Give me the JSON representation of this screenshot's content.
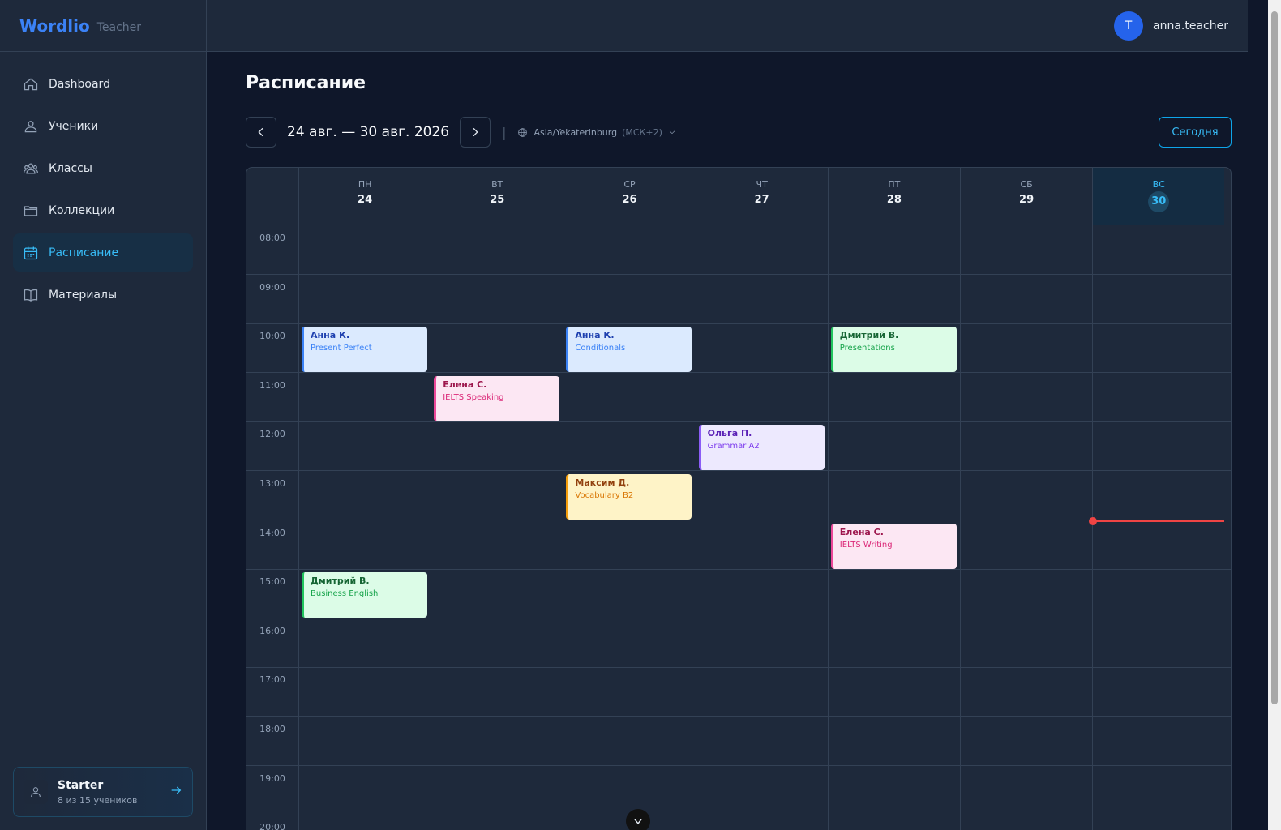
{
  "brand": {
    "name": "Wordlio",
    "role": "Teacher"
  },
  "nav": [
    {
      "label": "Dashboard",
      "icon": "home-icon"
    },
    {
      "label": "Ученики",
      "icon": "student-icon"
    },
    {
      "label": "Классы",
      "icon": "users-icon"
    },
    {
      "label": "Коллекции",
      "icon": "folder-icon"
    },
    {
      "label": "Расписание",
      "icon": "calendar-icon",
      "active": true
    },
    {
      "label": "Материалы",
      "icon": "book-icon"
    }
  ],
  "plan": {
    "title": "Starter",
    "subtitle": "8 из 15 учеников"
  },
  "user": {
    "initial": "T",
    "name": "anna.teacher"
  },
  "page": {
    "title": "Расписание"
  },
  "toolbar": {
    "range": "24 авг. — 30 авг. 2026",
    "separator": "|",
    "timezone": "Asia/Yekaterinburg",
    "timezone_offset": "(МСК+2)",
    "today_label": "Сегодня"
  },
  "calendar": {
    "days": [
      {
        "name": "ПН",
        "num": "24"
      },
      {
        "name": "ВТ",
        "num": "25"
      },
      {
        "name": "СР",
        "num": "26"
      },
      {
        "name": "ЧТ",
        "num": "27"
      },
      {
        "name": "ПТ",
        "num": "28"
      },
      {
        "name": "СБ",
        "num": "29"
      },
      {
        "name": "ВС",
        "num": "30",
        "today": true
      }
    ],
    "hours": [
      "08:00",
      "09:00",
      "10:00",
      "11:00",
      "12:00",
      "13:00",
      "14:00",
      "15:00",
      "16:00",
      "17:00",
      "18:00",
      "19:00",
      "20:00"
    ],
    "events": [
      {
        "day": 0,
        "hour": 10,
        "name": "Анна К.",
        "topic": "Present Perfect",
        "color": "blue"
      },
      {
        "day": 2,
        "hour": 10,
        "name": "Анна К.",
        "topic": "Conditionals",
        "color": "blue"
      },
      {
        "day": 4,
        "hour": 10,
        "name": "Дмитрий В.",
        "topic": "Presentations",
        "color": "green"
      },
      {
        "day": 1,
        "hour": 11,
        "name": "Елена С.",
        "topic": "IELTS Speaking",
        "color": "pink"
      },
      {
        "day": 3,
        "hour": 12,
        "name": "Ольга П.",
        "topic": "Grammar A2",
        "color": "purple"
      },
      {
        "day": 2,
        "hour": 13,
        "name": "Максим Д.",
        "topic": "Vocabulary B2",
        "color": "yellow"
      },
      {
        "day": 4,
        "hour": 14,
        "name": "Елена С.",
        "topic": "IELTS Writing",
        "color": "pink"
      },
      {
        "day": 0,
        "hour": 15,
        "name": "Дмитрий В.",
        "topic": "Business English",
        "color": "green"
      }
    ],
    "now": {
      "day": 6,
      "hour": 14.0
    }
  }
}
